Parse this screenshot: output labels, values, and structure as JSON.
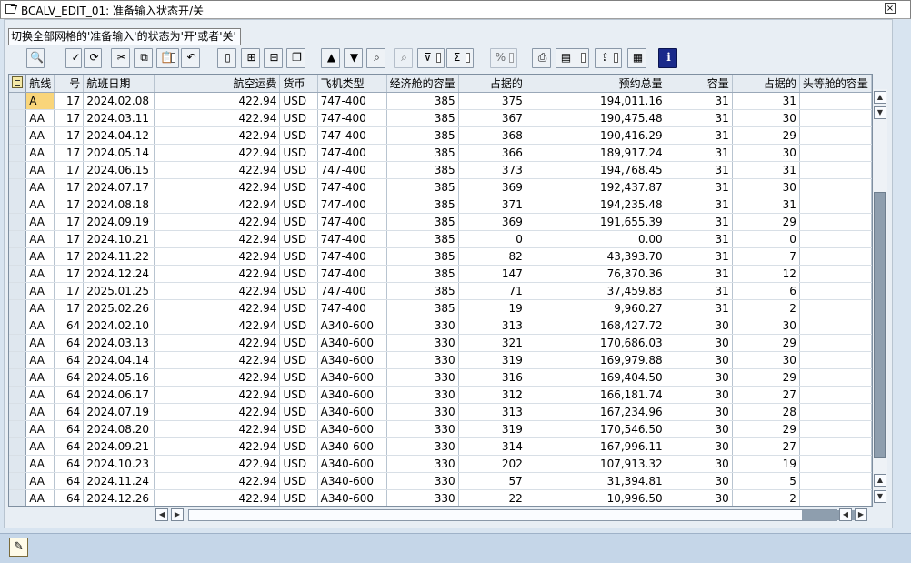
{
  "window": {
    "title": "BCALV_EDIT_01: 准备输入状态开/关",
    "close_glyph": "×"
  },
  "grid": {
    "title": "切换全部网格的'准备输入'的状态为'开'或者'关'",
    "toolbar": [
      {
        "name": "details-button",
        "glyph": "🔍",
        "dropdown": false,
        "disabled": false
      },
      {
        "name": "check-entries-button",
        "glyph": "✓",
        "dropdown": false,
        "disabled": false
      },
      {
        "name": "refresh-button",
        "glyph": "⟳",
        "dropdown": false,
        "disabled": false
      },
      {
        "name": "cut-button",
        "glyph": "✂",
        "dropdown": false,
        "disabled": false
      },
      {
        "name": "copy-button",
        "glyph": "⧉",
        "dropdown": false,
        "disabled": false
      },
      {
        "name": "paste-button",
        "glyph": "📋",
        "dropdown": true,
        "disabled": false
      },
      {
        "name": "undo-button",
        "glyph": "↶",
        "dropdown": false,
        "disabled": false
      },
      {
        "name": "append-row-button",
        "glyph": "▯",
        "dropdown": false,
        "disabled": false
      },
      {
        "name": "insert-row-button",
        "glyph": "⊞",
        "dropdown": false,
        "disabled": false
      },
      {
        "name": "delete-row-button",
        "glyph": "⊟",
        "dropdown": false,
        "disabled": false
      },
      {
        "name": "copy-row-button",
        "glyph": "❐",
        "dropdown": false,
        "disabled": false
      },
      {
        "name": "sort-ascending-button",
        "glyph": "▲",
        "dropdown": false,
        "disabled": false
      },
      {
        "name": "sort-descending-button",
        "glyph": "▼",
        "dropdown": false,
        "disabled": false
      },
      {
        "name": "find-button",
        "glyph": "⌕",
        "dropdown": false,
        "disabled": false
      },
      {
        "name": "find-next-button",
        "glyph": "⌕",
        "dropdown": false,
        "disabled": true
      },
      {
        "name": "filter-button",
        "glyph": "⊽",
        "dropdown": true,
        "disabled": false
      },
      {
        "name": "total-button",
        "glyph": "Σ",
        "dropdown": true,
        "disabled": false
      },
      {
        "name": "subtotal-button",
        "glyph": "%",
        "dropdown": true,
        "disabled": true
      },
      {
        "name": "print-button",
        "glyph": "⎙",
        "dropdown": false,
        "disabled": false
      },
      {
        "name": "views-button",
        "glyph": "▤",
        "dropdown": true,
        "disabled": false
      },
      {
        "name": "export-button",
        "glyph": "⇪",
        "dropdown": true,
        "disabled": false
      },
      {
        "name": "layout-button",
        "glyph": "▦",
        "dropdown": false,
        "disabled": false
      },
      {
        "name": "info-button",
        "glyph": "i",
        "dropdown": false,
        "disabled": false
      }
    ],
    "columns": [
      {
        "label": "航线",
        "align": "left",
        "w": 27
      },
      {
        "label": "号",
        "align": "right",
        "w": 33
      },
      {
        "label": "航班日期",
        "align": "left",
        "w": 78
      },
      {
        "label": "航空运费",
        "align": "right",
        "w": 146
      },
      {
        "label": "货币",
        "align": "left",
        "w": 42
      },
      {
        "label": "飞机类型",
        "align": "left",
        "w": 77
      },
      {
        "label": "经济舱的容量",
        "align": "right",
        "w": 77
      },
      {
        "label": "占据的",
        "align": "right",
        "w": 77
      },
      {
        "label": "预约总量",
        "align": "right",
        "w": 161
      },
      {
        "label": "容量",
        "align": "right",
        "w": 77
      },
      {
        "label": "占据的",
        "align": "right",
        "w": 77
      },
      {
        "label": "头等舱的容量",
        "align": "left",
        "w": 60
      }
    ],
    "rows": [
      [
        "A",
        "17",
        "2024.02.08",
        "422.94",
        "USD",
        "747-400",
        "385",
        "375",
        "194,011.16",
        "31",
        "31",
        ""
      ],
      [
        "AA",
        "17",
        "2024.03.11",
        "422.94",
        "USD",
        "747-400",
        "385",
        "367",
        "190,475.48",
        "31",
        "30",
        ""
      ],
      [
        "AA",
        "17",
        "2024.04.12",
        "422.94",
        "USD",
        "747-400",
        "385",
        "368",
        "190,416.29",
        "31",
        "29",
        ""
      ],
      [
        "AA",
        "17",
        "2024.05.14",
        "422.94",
        "USD",
        "747-400",
        "385",
        "366",
        "189,917.24",
        "31",
        "30",
        ""
      ],
      [
        "AA",
        "17",
        "2024.06.15",
        "422.94",
        "USD",
        "747-400",
        "385",
        "373",
        "194,768.45",
        "31",
        "31",
        ""
      ],
      [
        "AA",
        "17",
        "2024.07.17",
        "422.94",
        "USD",
        "747-400",
        "385",
        "369",
        "192,437.87",
        "31",
        "30",
        ""
      ],
      [
        "AA",
        "17",
        "2024.08.18",
        "422.94",
        "USD",
        "747-400",
        "385",
        "371",
        "194,235.48",
        "31",
        "31",
        ""
      ],
      [
        "AA",
        "17",
        "2024.09.19",
        "422.94",
        "USD",
        "747-400",
        "385",
        "369",
        "191,655.39",
        "31",
        "29",
        ""
      ],
      [
        "AA",
        "17",
        "2024.10.21",
        "422.94",
        "USD",
        "747-400",
        "385",
        "0",
        "0.00",
        "31",
        "0",
        ""
      ],
      [
        "AA",
        "17",
        "2024.11.22",
        "422.94",
        "USD",
        "747-400",
        "385",
        "82",
        "43,393.70",
        "31",
        "7",
        ""
      ],
      [
        "AA",
        "17",
        "2024.12.24",
        "422.94",
        "USD",
        "747-400",
        "385",
        "147",
        "76,370.36",
        "31",
        "12",
        ""
      ],
      [
        "AA",
        "17",
        "2025.01.25",
        "422.94",
        "USD",
        "747-400",
        "385",
        "71",
        "37,459.83",
        "31",
        "6",
        ""
      ],
      [
        "AA",
        "17",
        "2025.02.26",
        "422.94",
        "USD",
        "747-400",
        "385",
        "19",
        "9,960.27",
        "31",
        "2",
        ""
      ],
      [
        "AA",
        "64",
        "2024.02.10",
        "422.94",
        "USD",
        "A340-600",
        "330",
        "313",
        "168,427.72",
        "30",
        "30",
        ""
      ],
      [
        "AA",
        "64",
        "2024.03.13",
        "422.94",
        "USD",
        "A340-600",
        "330",
        "321",
        "170,686.03",
        "30",
        "29",
        ""
      ],
      [
        "AA",
        "64",
        "2024.04.14",
        "422.94",
        "USD",
        "A340-600",
        "330",
        "319",
        "169,979.88",
        "30",
        "30",
        ""
      ],
      [
        "AA",
        "64",
        "2024.05.16",
        "422.94",
        "USD",
        "A340-600",
        "330",
        "316",
        "169,404.50",
        "30",
        "29",
        ""
      ],
      [
        "AA",
        "64",
        "2024.06.17",
        "422.94",
        "USD",
        "A340-600",
        "330",
        "312",
        "166,181.74",
        "30",
        "27",
        ""
      ],
      [
        "AA",
        "64",
        "2024.07.19",
        "422.94",
        "USD",
        "A340-600",
        "330",
        "313",
        "167,234.96",
        "30",
        "28",
        ""
      ],
      [
        "AA",
        "64",
        "2024.08.20",
        "422.94",
        "USD",
        "A340-600",
        "330",
        "319",
        "170,546.50",
        "30",
        "29",
        ""
      ],
      [
        "AA",
        "64",
        "2024.09.21",
        "422.94",
        "USD",
        "A340-600",
        "330",
        "314",
        "167,996.11",
        "30",
        "27",
        ""
      ],
      [
        "AA",
        "64",
        "2024.10.23",
        "422.94",
        "USD",
        "A340-600",
        "330",
        "202",
        "107,913.32",
        "30",
        "19",
        ""
      ],
      [
        "AA",
        "64",
        "2024.11.24",
        "422.94",
        "USD",
        "A340-600",
        "330",
        "57",
        "31,394.81",
        "30",
        "5",
        ""
      ],
      [
        "AA",
        "64",
        "2024.12.26",
        "422.94",
        "USD",
        "A340-600",
        "330",
        "22",
        "10,996.50",
        "30",
        "2",
        ""
      ]
    ],
    "active_cell": [
      0,
      0
    ]
  },
  "scrollbars": {
    "up": "▲",
    "down": "▼",
    "left": "◀",
    "right": "▶"
  },
  "status": {
    "icon": "✎"
  }
}
